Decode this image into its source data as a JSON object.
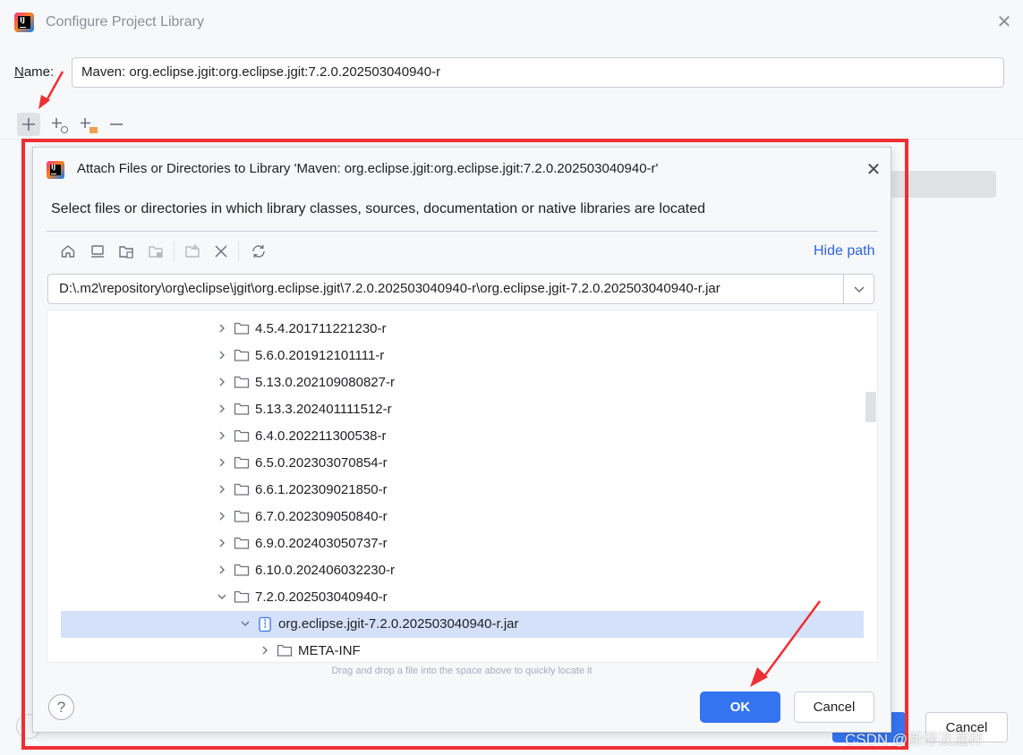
{
  "outer": {
    "title": "Configure Project Library",
    "name_label_prefix": "N",
    "name_label_rest": "ame:",
    "name_value": "Maven: org.eclipse.jgit:org.eclipse.jgit:7.2.0.202503040940-r",
    "bg_cancel_label": "Cancel",
    "toolbar_icons": [
      "add-icon",
      "add-from-maven-icon",
      "add-jar-icon",
      "remove-icon"
    ]
  },
  "dialog": {
    "title": "Attach Files or Directories to Library 'Maven: org.eclipse.jgit:org.eclipse.jgit:7.2.0.202503040940-r'",
    "description": "Select files or directories in which library classes, sources, documentation or native libraries are located",
    "hide_path": "Hide path",
    "path": "D:\\.m2\\repository\\org\\eclipse\\jgit\\org.eclipse.jgit\\7.2.0.202503040940-r\\org.eclipse.jgit-7.2.0.202503040940-r.jar",
    "tree": [
      {
        "label": "4.5.4.201711221230-r",
        "expanded": false,
        "type": "folder",
        "depth": 0
      },
      {
        "label": "5.6.0.201912101111-r",
        "expanded": false,
        "type": "folder",
        "depth": 0
      },
      {
        "label": "5.13.0.202109080827-r",
        "expanded": false,
        "type": "folder",
        "depth": 0
      },
      {
        "label": "5.13.3.202401111512-r",
        "expanded": false,
        "type": "folder",
        "depth": 0
      },
      {
        "label": "6.4.0.202211300538-r",
        "expanded": false,
        "type": "folder",
        "depth": 0
      },
      {
        "label": "6.5.0.202303070854-r",
        "expanded": false,
        "type": "folder",
        "depth": 0
      },
      {
        "label": "6.6.1.202309021850-r",
        "expanded": false,
        "type": "folder",
        "depth": 0
      },
      {
        "label": "6.7.0.202309050840-r",
        "expanded": false,
        "type": "folder",
        "depth": 0
      },
      {
        "label": "6.9.0.202403050737-r",
        "expanded": false,
        "type": "folder",
        "depth": 0
      },
      {
        "label": "6.10.0.202406032230-r",
        "expanded": false,
        "type": "folder",
        "depth": 0
      },
      {
        "label": "7.2.0.202503040940-r",
        "expanded": true,
        "type": "folder",
        "depth": 0
      },
      {
        "label": "org.eclipse.jgit-7.2.0.202503040940-r.jar",
        "expanded": true,
        "type": "jar",
        "depth": 1,
        "selected": true
      },
      {
        "label": "META-INF",
        "expanded": false,
        "type": "folder",
        "depth": 2
      }
    ],
    "drag_hint": "Drag and drop a file into the space above to quickly locate it",
    "help_label": "?",
    "ok_label": "OK",
    "cancel_label": "Cancel"
  },
  "watermark": "CSDN @新停淡酒杯",
  "colors": {
    "accent": "#3574f0",
    "highlight": "#ee2f34",
    "selection": "#d5e1fb",
    "link": "#2f64d8"
  }
}
